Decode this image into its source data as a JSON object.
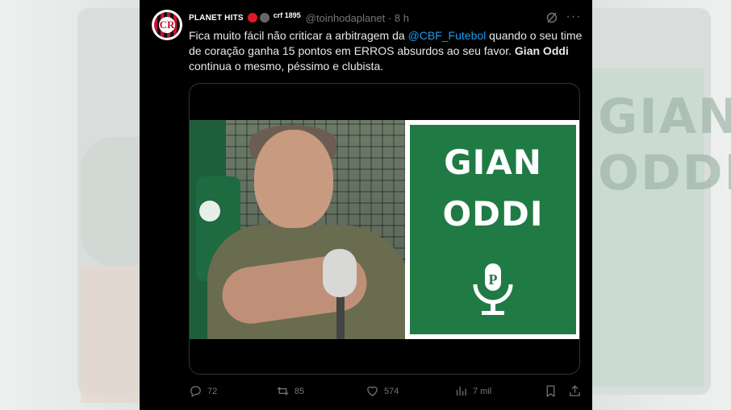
{
  "author": {
    "display_name": "PLANET HITS",
    "badge_text": "crf 1895",
    "handle": "@toinhodaplanet",
    "time": "8 h"
  },
  "tweet": {
    "text_before": "Fica muito fácil não criticar a arbitragem da ",
    "mention": "@CBF_Futebol",
    "text_middle": " quando o seu time de coração ganha 15 pontos em ERROS absurdos ao seu favor. ",
    "text_bold": "Gian Oddi",
    "text_after": " continua o mesmo, péssimo e clubista."
  },
  "media": {
    "panel_line1": "GIAN",
    "panel_line2": "ODDI",
    "panel_color": "#207a44"
  },
  "actions": {
    "replies": "72",
    "retweets": "85",
    "likes": "574",
    "views": "7 mil"
  },
  "icons": [
    "reply-icon",
    "retweet-icon",
    "like-icon",
    "views-icon",
    "bookmark-icon",
    "share-icon",
    "grok-icon",
    "more-icon"
  ],
  "colors": {
    "background": "#000000",
    "text": "#e7e9ea",
    "muted": "#71767b",
    "link": "#1d9bf0"
  }
}
